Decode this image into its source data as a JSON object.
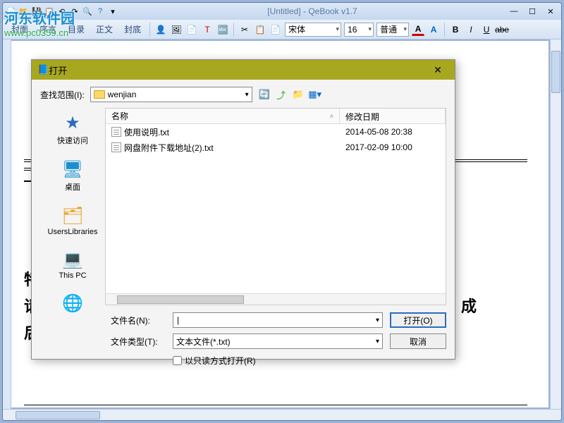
{
  "app": {
    "title": "[Untitled]  - QeBook v1.7",
    "watermark_main": "河东软件园",
    "watermark_sub": "www.pc0359.cn"
  },
  "nav": {
    "cover": "封面",
    "preface": "序言",
    "toc": "目录",
    "body": "正文",
    "back": "封底"
  },
  "toolbar": {
    "font_name": "宋体",
    "font_size": "16",
    "font_style": "普通"
  },
  "page_text": {
    "line1": "特别说明",
    "line2": "请大",
    "line3": "后，"
  },
  "dialog": {
    "title": "打开",
    "look_in_label": "查找范围(I):",
    "folder": "wenjian",
    "col_name": "名称",
    "col_date": "修改日期",
    "files": [
      {
        "name": "使用说明.txt",
        "date": "2014-05-08 20:38"
      },
      {
        "name": "网盘附件下载地址(2).txt",
        "date": "2017-02-09 10:00"
      }
    ],
    "places": {
      "quick": "快速访问",
      "desktop": "桌面",
      "libraries": "UsersLibraries",
      "thispc": "This PC"
    },
    "filename_label": "文件名(N):",
    "filetype_label": "文件类型(T):",
    "filetype_value": "文本文件(*.txt)",
    "readonly_label": "以只读方式打开(R)",
    "open_btn": "打开(O)",
    "cancel_btn": "取消"
  }
}
